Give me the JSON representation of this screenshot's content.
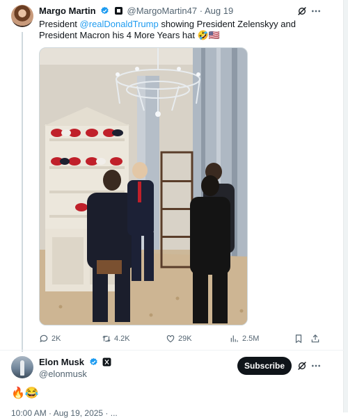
{
  "tweet1": {
    "author_name": "Margo Martin",
    "handle": "@MargoMartin47",
    "separator": "·",
    "date": "Aug 19",
    "text_before": "President ",
    "mention": "@realDonaldTrump",
    "text_after": " showing President Zelenskyy and President Macron his 4 More Years hat 🤣🇺🇸",
    "image_icon": "photo-oval-office-hats",
    "stats": {
      "replies": "2K",
      "reposts": "4.2K",
      "likes": "29K",
      "views": "2.5M"
    }
  },
  "tweet2": {
    "author_name": "Elon Musk",
    "handle": "@elonmusk",
    "subscribe_label": "Subscribe",
    "text": "🔥😂",
    "partial_line": "10:00 AM · Aug 19, 2025 · ..."
  },
  "colors": {
    "accent": "#1d9bf0",
    "text": "#0f1419",
    "muted": "#536471",
    "verified": "#1d9bf0"
  }
}
